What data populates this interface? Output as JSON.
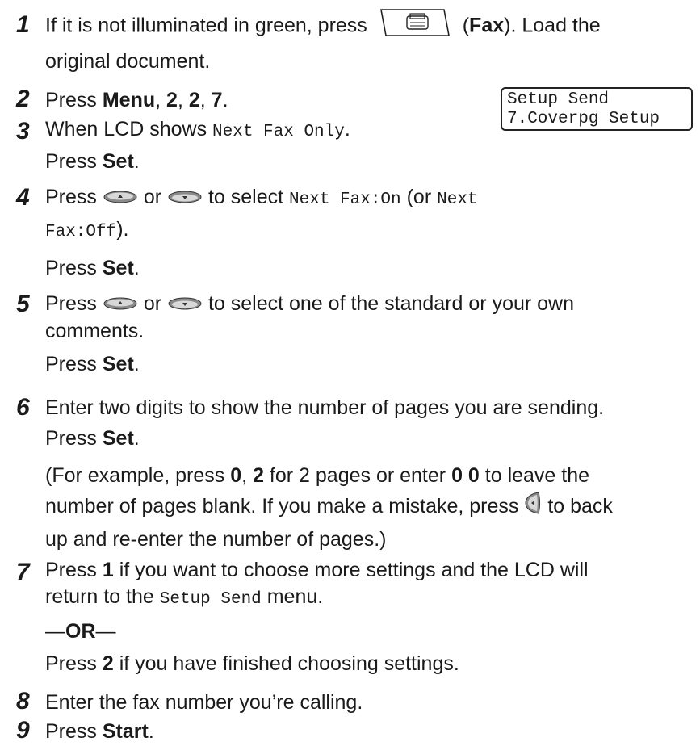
{
  "steps": {
    "s1": {
      "num": "1",
      "a1": "If it is not illuminated in green, press",
      "a2": "(",
      "fax": "Fax",
      "a3": "). Load the",
      "b1": "original document."
    },
    "s2": {
      "num": "2",
      "a1": "Press ",
      "menu": "Menu",
      "sep1": ", ",
      "k1": "2",
      "sep2": ", ",
      "k2": "2",
      "sep3": ", ",
      "k3": "7",
      "end": "."
    },
    "s3": {
      "num": "3",
      "a1": "When LCD shows ",
      "code": "Next Fax Only",
      "end": ".",
      "b1": "Press ",
      "set": "Set",
      "b2": "."
    },
    "s4": {
      "num": "4",
      "a1": "Press",
      "or": "or",
      "a2": "to select",
      "code1": "Next Fax:On",
      "a3": "(or",
      "code2a": "Next",
      "code2b": "Fax:Off",
      "a4": ").",
      "c1": "Press ",
      "set": "Set",
      "c2": "."
    },
    "s5": {
      "num": "5",
      "a1": "Press",
      "or": "or",
      "a2": "to select one of the standard or your own",
      "b1": "comments.",
      "c1": "Press ",
      "set": "Set",
      "c2": "."
    },
    "s6": {
      "num": "6",
      "a1": "Enter two digits to show the number of pages you are sending.",
      "b1": "Press ",
      "set": "Set",
      "b2": ".",
      "c1": "(For example, press ",
      "c_k1": "0",
      "c2": ", ",
      "c_k2": "2",
      "c3": " for 2 pages or enter ",
      "c_k3": "0 0",
      "c4": " to leave the",
      "d1": "number of pages blank. If you make a mistake, press",
      "d2": "to back",
      "e1": "up and re-enter the number of pages.)"
    },
    "s7": {
      "num": "7",
      "a1": "Press ",
      "k1": "1",
      "a2": " if you want to choose more settings and the LCD will",
      "b1": "return to the ",
      "code": "Setup Send",
      "b2": " menu.",
      "or_line": "—OR—",
      "or_prefix": "—",
      "or_bold": "OR",
      "or_suffix": "—",
      "d1": "Press ",
      "k2": "2",
      "d2": " if you have finished choosing settings."
    },
    "s8": {
      "num": "8",
      "a1": "Enter the fax number you’re calling."
    },
    "s9": {
      "num": "9",
      "a1": "Press ",
      "start": "Start",
      "end": "."
    }
  },
  "lcd": {
    "line1": "Setup Send",
    "line2": "7.Coverpg Setup"
  },
  "icons": {
    "fax_button": "fax-icon",
    "up_key": "up-arrow-oval-key-icon",
    "down_key": "down-arrow-oval-key-icon",
    "back_key": "left-arrow-round-key-icon"
  }
}
